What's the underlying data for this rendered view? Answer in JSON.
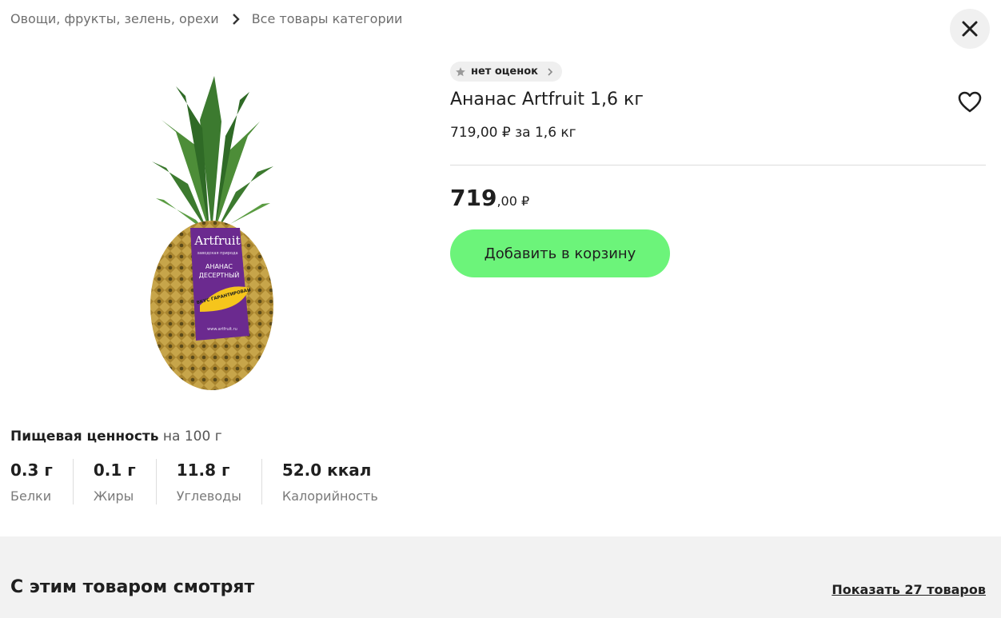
{
  "breadcrumbs": {
    "category": "Овощи, фрукты, зелень, орехи",
    "all_items": "Все товары категории"
  },
  "product": {
    "rating_text": "нет оценок",
    "title": "Ананас Artfruit 1,6 кг",
    "unit_price": "719,00 ₽ за 1,6 кг",
    "price_main": "719",
    "price_cents": ",00 ₽",
    "add_to_cart": "Добавить в корзину",
    "image_label": {
      "brand": "Artfruit",
      "tagline": "заводская природа",
      "line1": "АНАНАС",
      "line2": "ДЕСЕРТНЫЙ",
      "sticker": "ВКУС ГАРАНТИРОВАН",
      "site": "www.artfruit.ru"
    }
  },
  "nutrition": {
    "heading": "Пищевая ценность",
    "per": "на 100 г",
    "items": [
      {
        "value": "0.3 г",
        "label": "Белки"
      },
      {
        "value": "0.1 г",
        "label": "Жиры"
      },
      {
        "value": "11.8 г",
        "label": "Углеводы"
      },
      {
        "value": "52.0 ккал",
        "label": "Калорийность"
      }
    ]
  },
  "related": {
    "heading": "С этим товаром смотрят",
    "show_all": "Показать 27 товаров"
  },
  "colors": {
    "accent_button": "#6cf47a",
    "label_purple": "#6b2a8f",
    "bottom_bg": "#f2f2f2"
  },
  "icons": {
    "breadcrumb_separator": "chevron-right-icon",
    "close": "close-icon",
    "rating": "star-icon",
    "favorite": "heart-icon"
  }
}
